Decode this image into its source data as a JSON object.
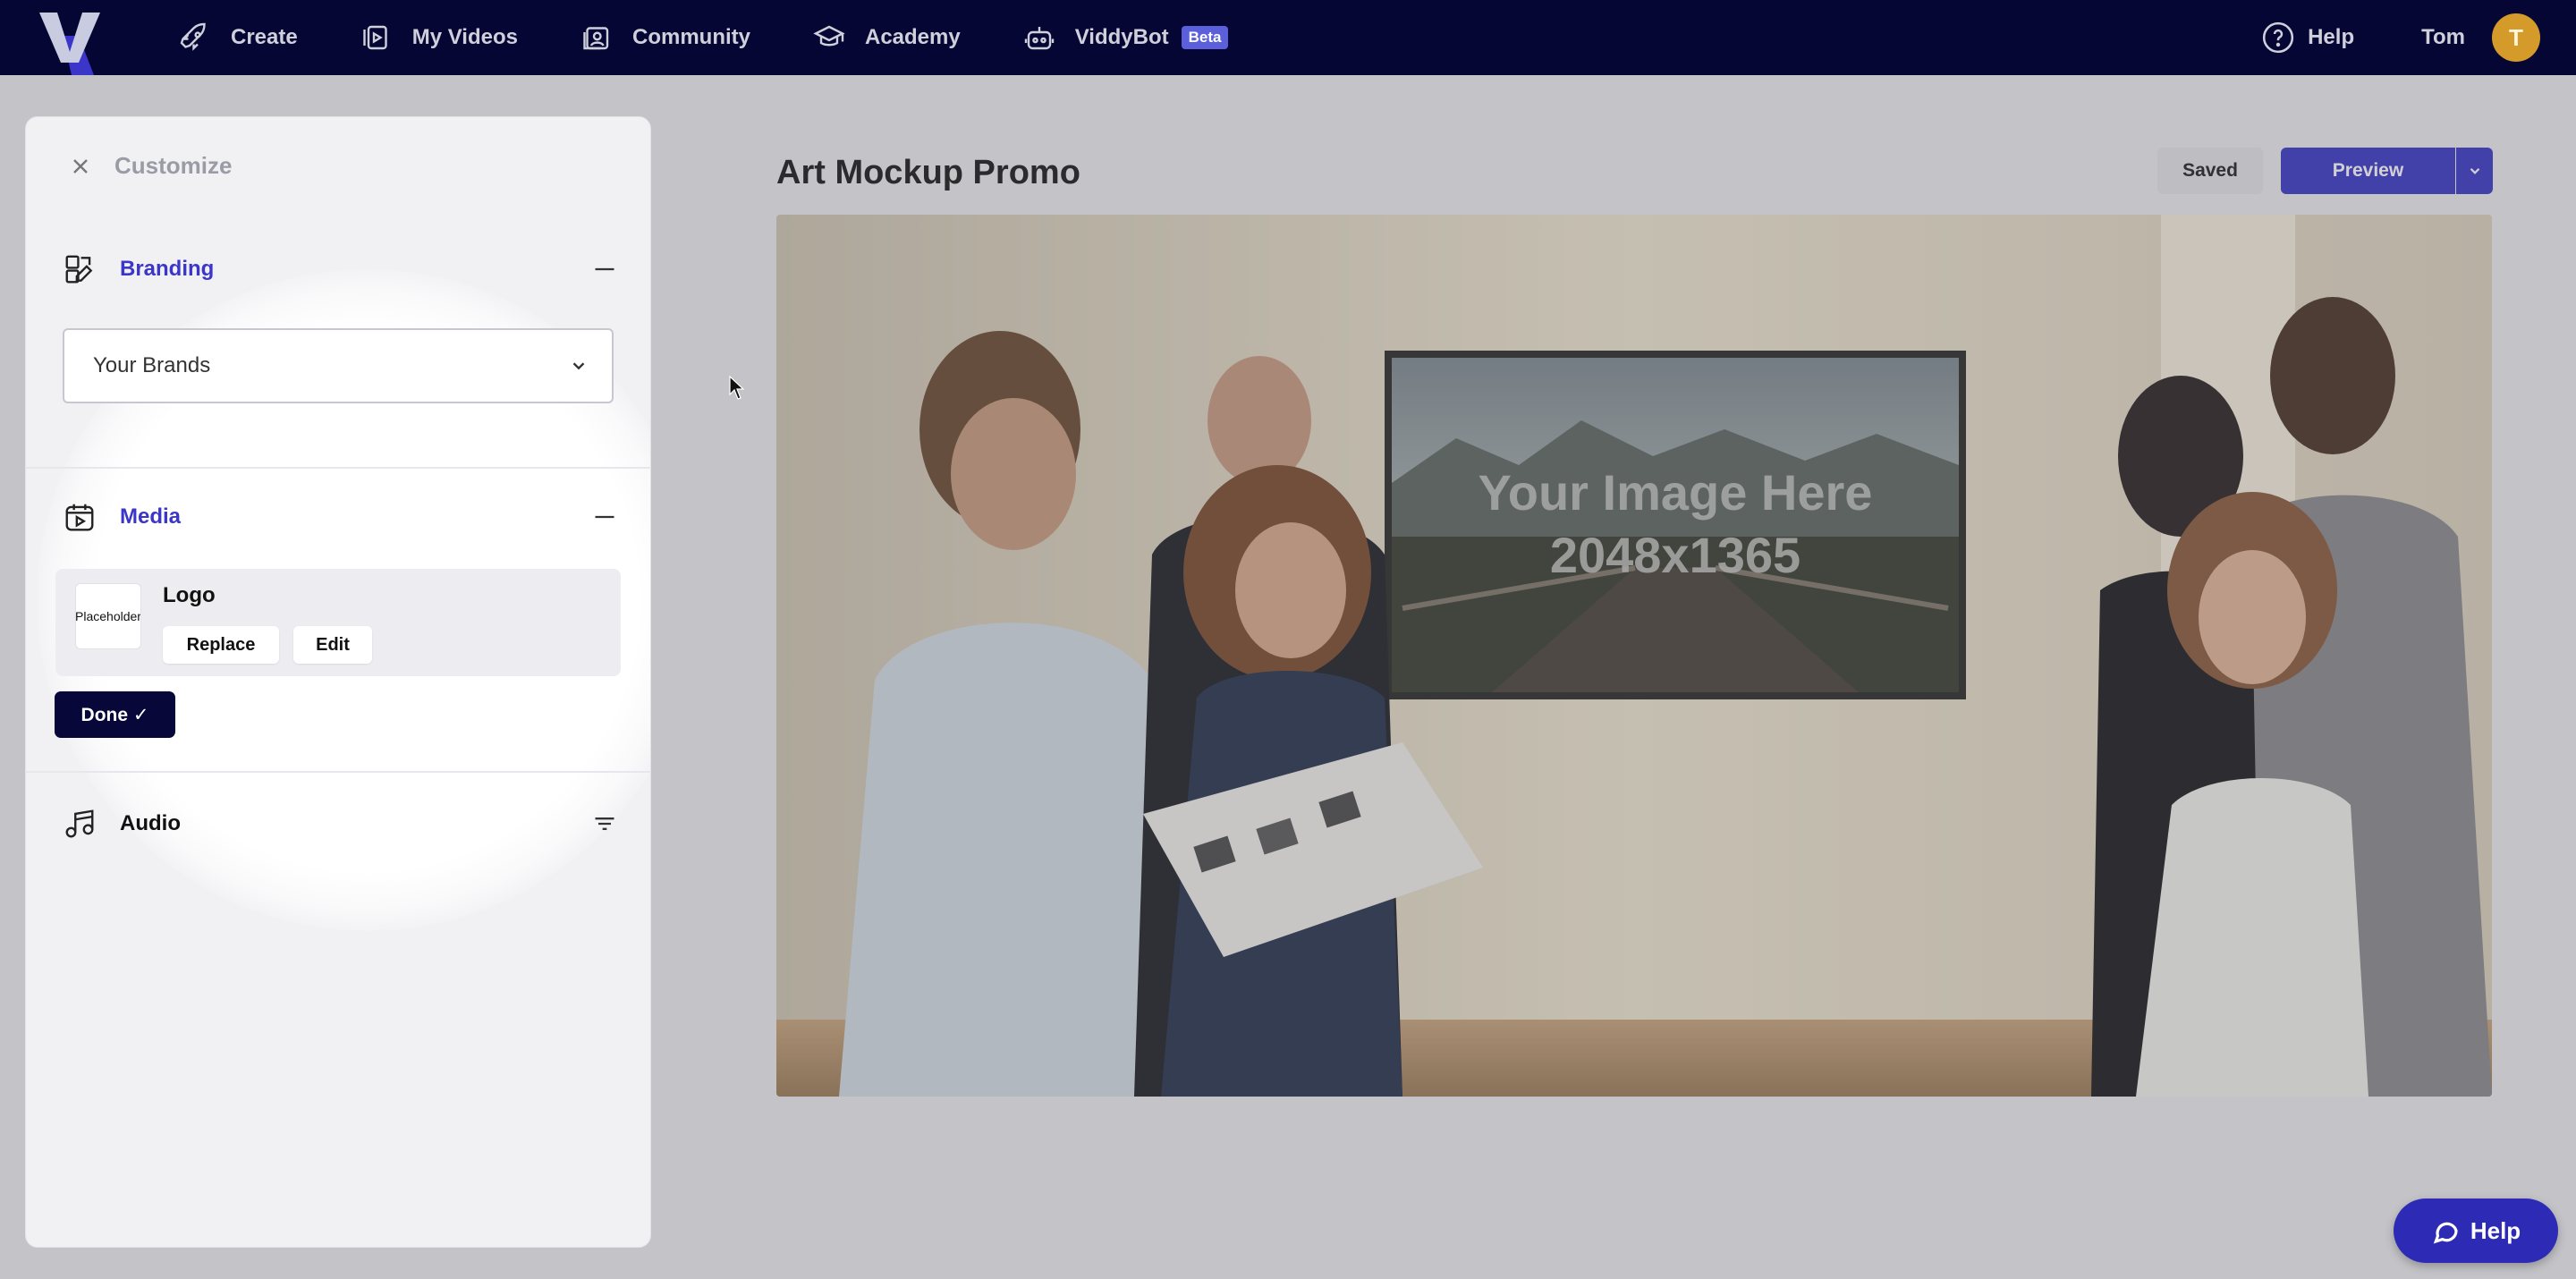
{
  "nav": {
    "items": [
      {
        "label": "Create",
        "icon": "rocket-icon"
      },
      {
        "label": "My Videos",
        "icon": "videos-icon"
      },
      {
        "label": "Community",
        "icon": "community-icon"
      },
      {
        "label": "Academy",
        "icon": "graduation-cap-icon"
      },
      {
        "label": "ViddyBot",
        "icon": "robot-icon",
        "badge": "Beta"
      }
    ],
    "help_label": "Help",
    "user_name": "Tom",
    "avatar_initial": "T"
  },
  "panel": {
    "title": "Customize",
    "branding": {
      "title": "Branding",
      "select_value": "Your Brands"
    },
    "media": {
      "title": "Media",
      "item": {
        "name": "Logo",
        "thumb_text": "Placeholder",
        "replace_label": "Replace",
        "edit_label": "Edit"
      },
      "done_label": "Done ✓"
    },
    "audio": {
      "title": "Audio"
    }
  },
  "main": {
    "title": "Art Mockup Promo",
    "saved_label": "Saved",
    "preview_label": "Preview",
    "canvas_text_line1": "Your Image Here",
    "canvas_text_line2": "2048x1365"
  },
  "chat": {
    "label": "Help"
  },
  "colors": {
    "nav_bg": "#050633",
    "accent": "#3a38c4",
    "section_blue": "#3b36c9",
    "avatar": "#d49a2a"
  }
}
